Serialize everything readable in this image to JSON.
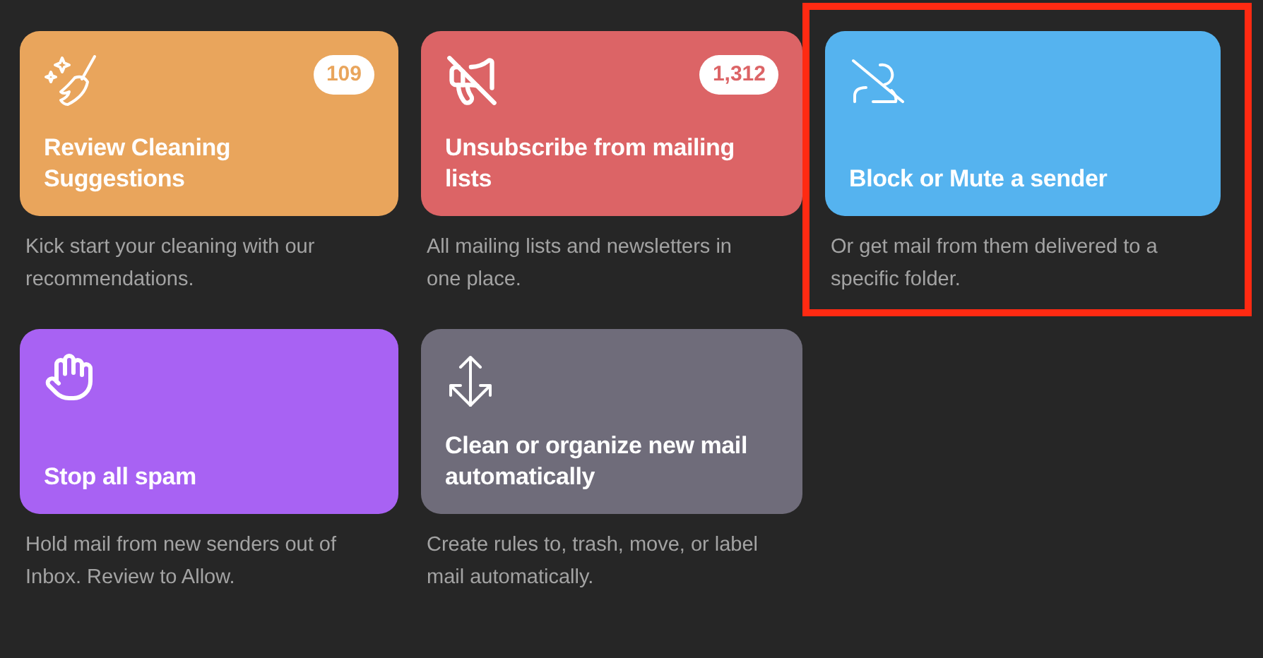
{
  "cards": [
    {
      "kind": "broom",
      "title": "Review Cleaning Suggestions",
      "badge": "109",
      "description": "Kick start your cleaning with our recommendations.",
      "color": "#e9a55c",
      "highlighted": false
    },
    {
      "kind": "megaphone-off",
      "title": "Unsubscribe from mailing lists",
      "badge": "1,312",
      "description": "All mailing lists and newsletters in one place.",
      "color": "#dc6466",
      "highlighted": false
    },
    {
      "kind": "person-off",
      "title": "Block or Mute a sender",
      "description": "Or get mail from them delivered to a specific folder.",
      "color": "#55b3ef",
      "highlighted": true
    },
    {
      "kind": "hand",
      "title": "Stop all spam",
      "description": "Hold mail from new senders out of Inbox. Review to Allow.",
      "color": "#a862f3",
      "highlighted": false
    },
    {
      "kind": "arrows",
      "title": "Clean or organize new mail automatically",
      "description": "Create rules to, trash, move, or label mail automatically.",
      "color": "#6f6c7a",
      "highlighted": false
    }
  ]
}
